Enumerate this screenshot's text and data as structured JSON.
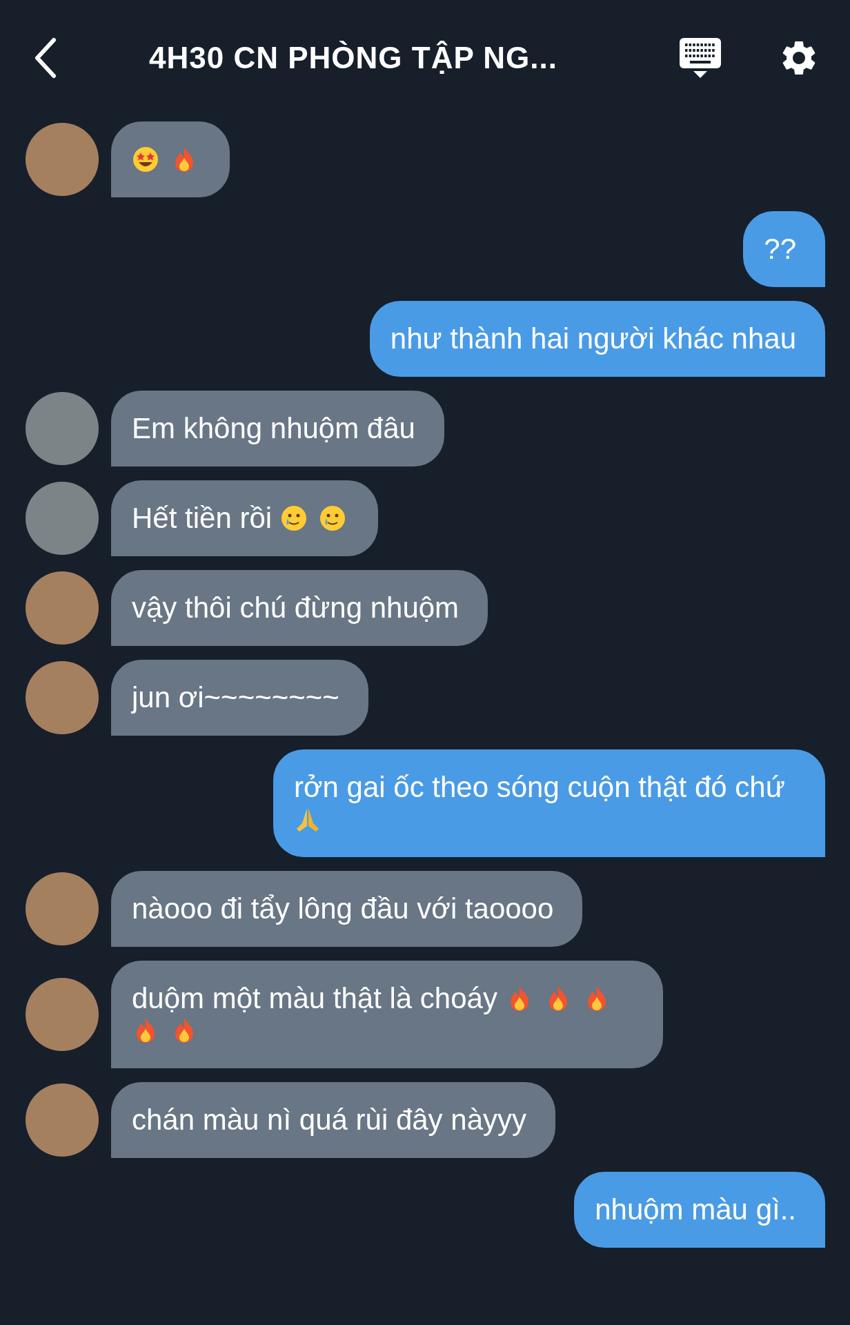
{
  "header": {
    "title": "4H30 CN PHÒNG TẬP NG..."
  },
  "messages": [
    {
      "kind": "received",
      "color": "#a5805f",
      "parts": [
        {
          "kind": "star-eyes"
        },
        {
          "kind": "fire"
        }
      ]
    },
    {
      "kind": "sent",
      "parts": [
        {
          "kind": "text",
          "text": "??"
        }
      ]
    },
    {
      "kind": "sent",
      "parts": [
        {
          "kind": "text",
          "text": "như thành hai người khác nhau"
        }
      ]
    },
    {
      "kind": "received",
      "color": "#7d8488",
      "parts": [
        {
          "kind": "text",
          "text": "Em không nhuộm đâu"
        }
      ]
    },
    {
      "kind": "received",
      "color": "#7d8488",
      "parts": [
        {
          "kind": "text",
          "text": "Hết tiền rồi"
        },
        {
          "kind": "tear-smile"
        },
        {
          "kind": "tear-smile"
        }
      ]
    },
    {
      "kind": "received",
      "color": "#a5805f",
      "parts": [
        {
          "kind": "text",
          "text": "vậy thôi chú đừng nhuộm"
        }
      ]
    },
    {
      "kind": "received",
      "color": "#a5805f",
      "parts": [
        {
          "kind": "text",
          "text": "jun ơi~~~~~~~~"
        }
      ]
    },
    {
      "kind": "sent",
      "parts": [
        {
          "kind": "text",
          "text": "rởn gai ốc theo sóng cuộn thật đó chứ"
        },
        {
          "kind": "pray"
        }
      ]
    },
    {
      "kind": "received",
      "color": "#a5805f",
      "parts": [
        {
          "kind": "text",
          "text": "nàooo đi tẩy lông đầu với taoooo"
        }
      ]
    },
    {
      "kind": "received",
      "color": "#a5805f",
      "parts": [
        {
          "kind": "text",
          "text": "duộm một màu thật là choáy"
        },
        {
          "kind": "fire"
        },
        {
          "kind": "fire"
        },
        {
          "kind": "fire"
        },
        {
          "kind": "fire"
        },
        {
          "kind": "fire"
        }
      ]
    },
    {
      "kind": "received",
      "color": "#a5805f",
      "parts": [
        {
          "kind": "text",
          "text": "chán màu nì quá rùi đây nàyyy"
        }
      ]
    },
    {
      "kind": "sent",
      "parts": [
        {
          "kind": "text",
          "text": "nhuộm màu gì.."
        }
      ]
    }
  ]
}
